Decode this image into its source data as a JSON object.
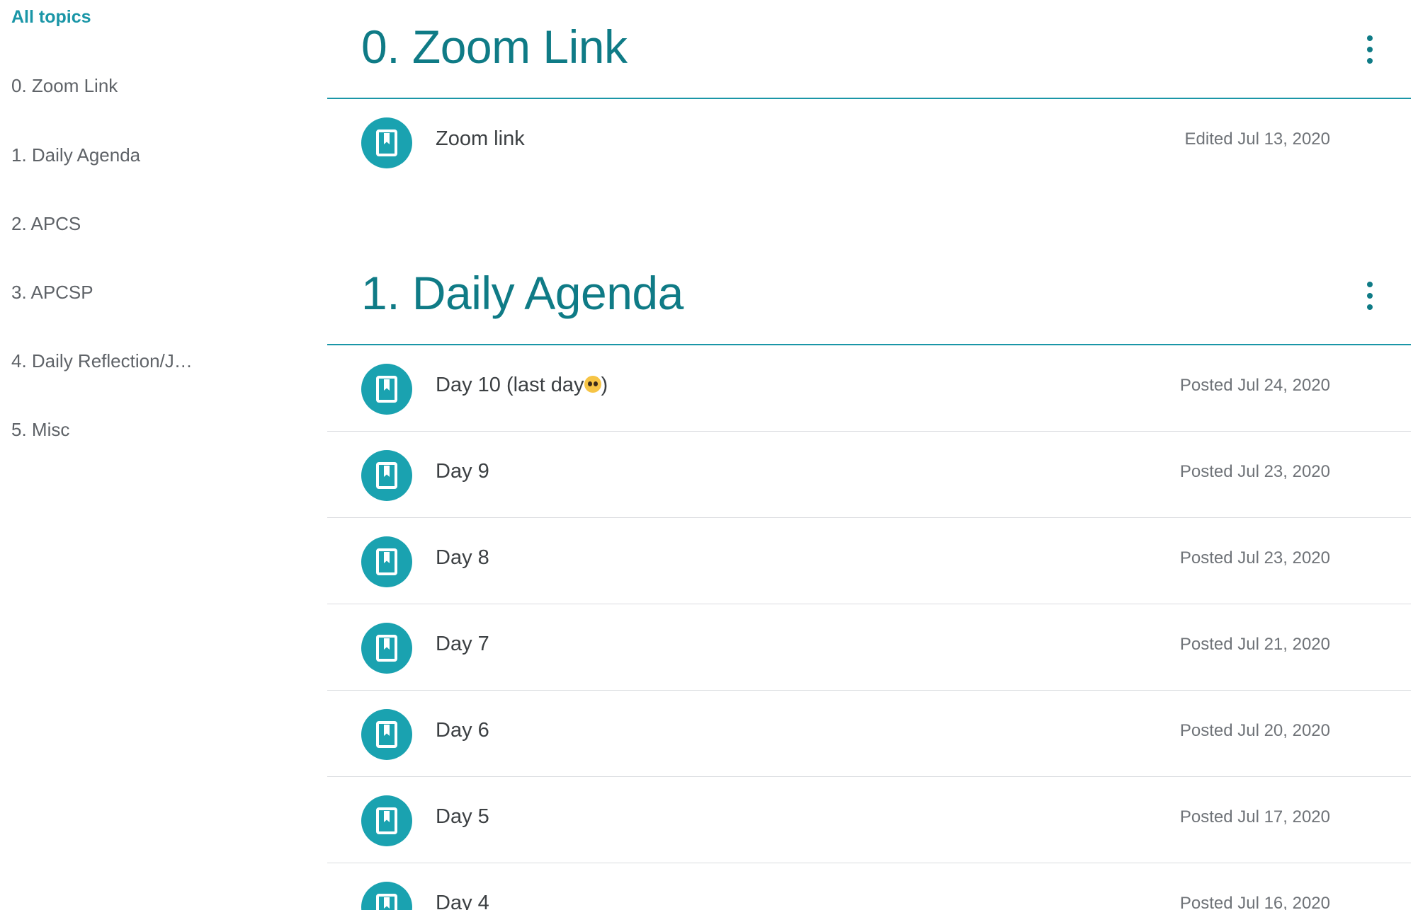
{
  "sidebar": {
    "active_label": "All topics",
    "items": [
      {
        "label": "0. Zoom Link"
      },
      {
        "label": "1. Daily Agenda"
      },
      {
        "label": "2. APCS"
      },
      {
        "label": "3. APCSP"
      },
      {
        "label": "4. Daily Reflection/J…"
      },
      {
        "label": "5. Misc"
      }
    ]
  },
  "sections": [
    {
      "title": "0. Zoom Link",
      "rows": [
        {
          "title": "Zoom link",
          "date": "Edited Jul 13, 2020",
          "icon": "material-bookmark-icon"
        }
      ]
    },
    {
      "title": "1. Daily Agenda",
      "rows": [
        {
          "title": "Day 10 (last day",
          "suffix": ")",
          "emoji": "pleading-face-emoji",
          "date": "Posted Jul 24, 2020",
          "icon": "material-bookmark-icon"
        },
        {
          "title": "Day 9",
          "date": "Posted Jul 23, 2020",
          "icon": "material-bookmark-icon"
        },
        {
          "title": "Day 8",
          "date": "Posted Jul 23, 2020",
          "icon": "material-bookmark-icon"
        },
        {
          "title": "Day 7",
          "date": "Posted Jul 21, 2020",
          "icon": "material-bookmark-icon"
        },
        {
          "title": "Day 6",
          "date": "Posted Jul 20, 2020",
          "icon": "material-bookmark-icon"
        },
        {
          "title": "Day 5",
          "date": "Posted Jul 17, 2020",
          "icon": "material-bookmark-icon"
        },
        {
          "title": "Day 4",
          "date": "Posted Jul 16, 2020",
          "icon": "material-bookmark-icon"
        }
      ]
    }
  ],
  "colors": {
    "accent": "#1a96a7",
    "title": "#0f7b86",
    "icon_bg": "#1aa2b0",
    "divider": "#dadce0",
    "secondary_text": "#5f6368"
  }
}
